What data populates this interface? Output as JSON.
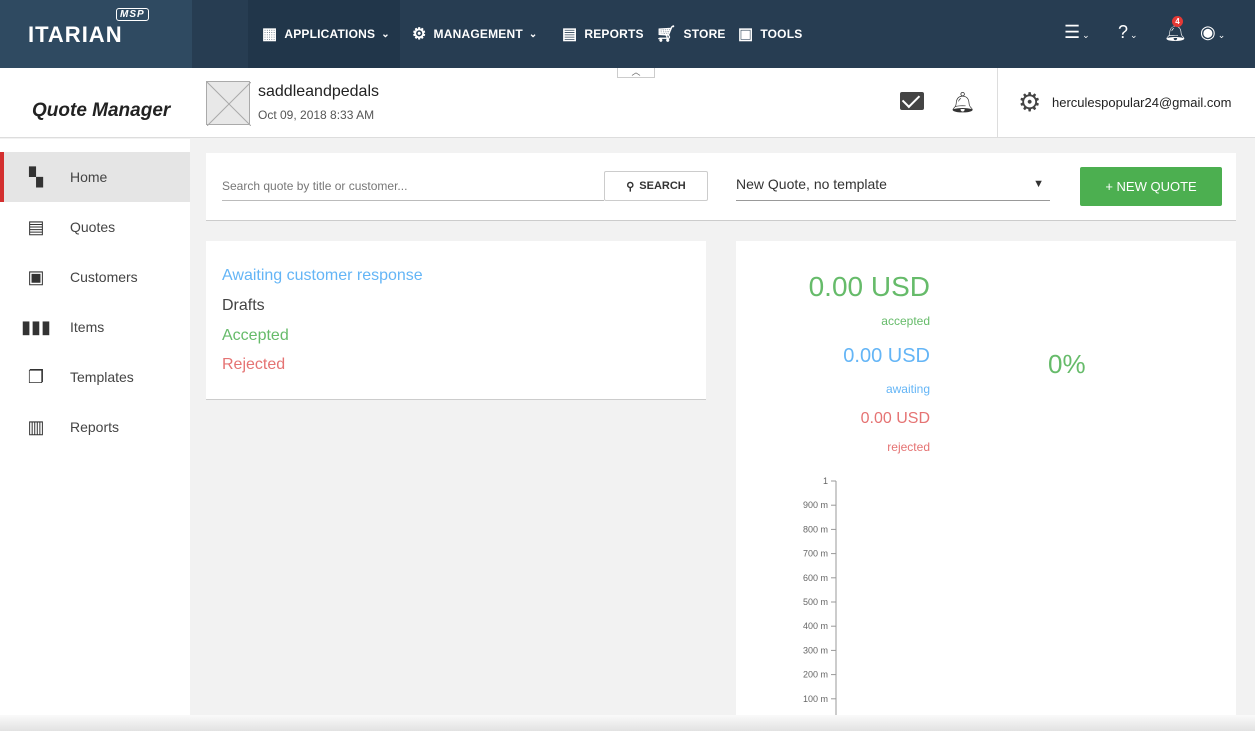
{
  "brand": {
    "name": "ITARIAN",
    "tag": "MSP"
  },
  "nav": [
    {
      "label": "APPLICATIONS",
      "icon": "grid-icon",
      "has_menu": true
    },
    {
      "label": "MANAGEMENT",
      "icon": "gears-icon",
      "has_menu": true
    },
    {
      "label": "REPORTS",
      "icon": "report-icon",
      "has_menu": false
    },
    {
      "label": "STORE",
      "icon": "cart-icon",
      "has_menu": false
    },
    {
      "label": "TOOLS",
      "icon": "toolbox-icon",
      "has_menu": false
    }
  ],
  "notifications_count": "4",
  "app_title": "Quote Manager",
  "tenant": {
    "name": "saddleandpedals",
    "date": "Oct 09, 2018 8:33 AM"
  },
  "user_email": "herculespopular24@gmail.com",
  "sidebar": {
    "items": [
      {
        "label": "Home",
        "icon": "dashboard-icon"
      },
      {
        "label": "Quotes",
        "icon": "quote-list-icon"
      },
      {
        "label": "Customers",
        "icon": "contact-card-icon"
      },
      {
        "label": "Items",
        "icon": "items-icon"
      },
      {
        "label": "Templates",
        "icon": "copy-icon"
      },
      {
        "label": "Reports",
        "icon": "bar-chart-icon"
      }
    ]
  },
  "search": {
    "placeholder": "Search quote by title or customer...",
    "button_label": "SEARCH"
  },
  "template_select": {
    "value": "New Quote, no template"
  },
  "new_quote_label": "+ NEW QUOTE",
  "statuses": [
    {
      "label": "Awaiting customer response",
      "color": "#64b5f6"
    },
    {
      "label": "Drafts",
      "color": "#444444"
    },
    {
      "label": "Accepted",
      "color": "#66bb6a"
    },
    {
      "label": "Rejected",
      "color": "#e57373"
    }
  ],
  "summary": {
    "accepted": {
      "amount": "0.00 USD",
      "label": "accepted",
      "color": "#66bb6a"
    },
    "awaiting": {
      "amount": "0.00 USD",
      "label": "awaiting",
      "color": "#64b5f6"
    },
    "rejected": {
      "amount": "0.00 USD",
      "label": "rejected",
      "color": "#e57373"
    },
    "percent": "0%"
  },
  "chart_data": {
    "type": "bar",
    "categories": [],
    "values": [],
    "ylim": [
      0,
      1
    ],
    "ytick_labels": [
      "1",
      "900 m",
      "800 m",
      "700 m",
      "600 m",
      "500 m",
      "400 m",
      "300 m",
      "200 m",
      "100 m"
    ]
  }
}
